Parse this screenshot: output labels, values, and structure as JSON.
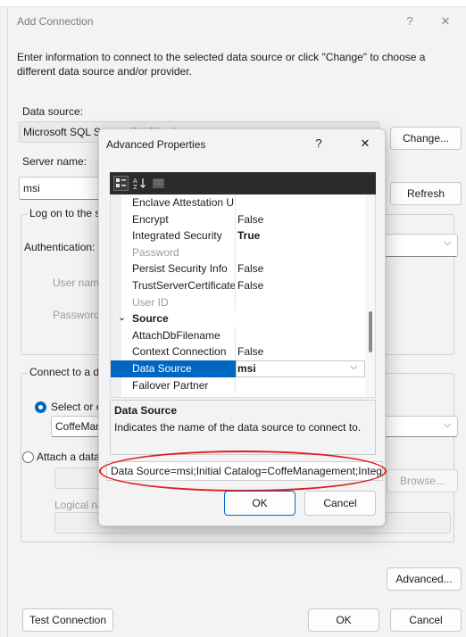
{
  "main_dialog": {
    "title": "Add Connection",
    "help_glyph": "?",
    "close_glyph": "✕",
    "intro": "Enter information to connect to the selected data source or click \"Change\" to choose a different data source and/or provider.",
    "data_source_label": "Data source:",
    "data_source_value": "Microsoft SQL Server (SqlClient)",
    "change_button": "Change...",
    "server_name_label": "Server name:",
    "server_name_value": "msi",
    "refresh_button": "Refresh",
    "logon_group": "Log on to the server",
    "authentication_label": "Authentication:",
    "user_name_label": "User name:",
    "password_label": "Password:",
    "connect_group": "Connect to a database",
    "select_db_label": "Select or enter a database name:",
    "database_value": "CoffeManagement",
    "attach_label": "Attach a database file:",
    "browse_button": "Browse...",
    "logical_name_label": "Logical name:",
    "advanced_button": "Advanced...",
    "test_button": "Test Connection",
    "ok_button": "OK",
    "cancel_button": "Cancel"
  },
  "advanced_dialog": {
    "title": "Advanced Properties",
    "help_glyph": "?",
    "close_glyph": "✕",
    "toolbar_icons": [
      "categorized-icon",
      "alphabetical-icon",
      "property-pages-icon"
    ],
    "properties": [
      {
        "name": "Enclave Attestation U",
        "value": "",
        "kind": "prop"
      },
      {
        "name": "Encrypt",
        "value": "False",
        "kind": "prop"
      },
      {
        "name": "Integrated Security",
        "value": "True",
        "kind": "bold"
      },
      {
        "name": "Password",
        "value": "",
        "kind": "grey"
      },
      {
        "name": "Persist Security Info",
        "value": "False",
        "kind": "prop"
      },
      {
        "name": "TrustServerCertificate",
        "value": "False",
        "kind": "prop"
      },
      {
        "name": "User ID",
        "value": "",
        "kind": "grey"
      },
      {
        "name": "Source",
        "value": "",
        "kind": "cat"
      },
      {
        "name": "AttachDbFilename",
        "value": "",
        "kind": "prop"
      },
      {
        "name": "Context Connection",
        "value": "False",
        "kind": "prop"
      },
      {
        "name": "Data Source",
        "value": "msi",
        "kind": "sel"
      },
      {
        "name": "Failover Partner",
        "value": "",
        "kind": "prop"
      }
    ],
    "desc_title": "Data Source",
    "desc_text": "Indicates the name of the data source to connect to.",
    "connection_string": "Data Source=msi;Initial Catalog=CoffeManagement;Integrated Security=True",
    "ok_button": "OK",
    "cancel_button": "Cancel"
  },
  "colors": {
    "accent": "#0067c0",
    "highlight_ellipse": "#e11b1b",
    "toolbar_bg": "#2b2b2b"
  }
}
